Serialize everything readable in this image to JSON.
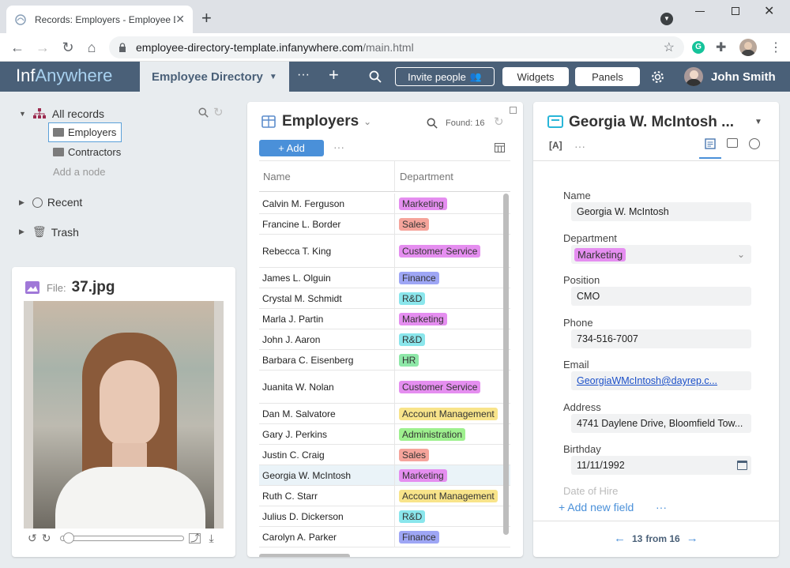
{
  "browser": {
    "tab_title": "Records: Employers - Employee D",
    "new_tab_label": "+",
    "url_host": "employee-directory-template.infanywhere.com",
    "url_path": "/main.html"
  },
  "app": {
    "logo_inf": "Inf",
    "logo_anywhere": "Anywhere",
    "directory_tab": "Employee Directory",
    "invite_label": "Invite people",
    "widgets_label": "Widgets",
    "panels_label": "Panels",
    "user_name": "John Smith",
    "more_label": "···",
    "add_label": "+"
  },
  "tree": {
    "all_records": "All records",
    "employers": "Employers",
    "contractors": "Contractors",
    "add_node": "Add a node",
    "recent": "Recent",
    "trash": "Trash"
  },
  "file_panel": {
    "file_label": "File:",
    "file_name": "37.jpg"
  },
  "table": {
    "title": "Employers",
    "found_label": "Found: 16",
    "add_label": "+ Add",
    "col_name": "Name",
    "col_department": "Department",
    "rows": [
      {
        "name": "Calvin M. Ferguson",
        "dept": "Marketing"
      },
      {
        "name": "Francine L. Border",
        "dept": "Sales"
      },
      {
        "name": "Rebecca T. King",
        "dept": "Customer Service"
      },
      {
        "name": "James L. Olguin",
        "dept": "Finance"
      },
      {
        "name": "Crystal M. Schmidt",
        "dept": "R&D"
      },
      {
        "name": "Marla J. Partin",
        "dept": "Marketing"
      },
      {
        "name": "John J. Aaron",
        "dept": "R&D"
      },
      {
        "name": "Barbara C. Eisenberg",
        "dept": "HR"
      },
      {
        "name": "Juanita W. Nolan",
        "dept": "Customer Service"
      },
      {
        "name": "Dan M. Salvatore",
        "dept": "Account Management"
      },
      {
        "name": "Gary J. Perkins",
        "dept": "Administration"
      },
      {
        "name": "Justin C. Craig",
        "dept": "Sales"
      },
      {
        "name": "Georgia W. McIntosh",
        "dept": "Marketing"
      },
      {
        "name": "Ruth C. Starr",
        "dept": "Account Management"
      },
      {
        "name": "Julius D. Dickerson",
        "dept": "R&D"
      },
      {
        "name": "Carolyn A. Parker",
        "dept": "Finance"
      }
    ]
  },
  "dept_colors": {
    "Marketing": "#e58ef0",
    "Sales": "#f5a49b",
    "Customer Service": "#e58ef0",
    "Finance": "#9ea6f5",
    "R&D": "#8ae6ec",
    "HR": "#8ee8a8",
    "Account Management": "#f8e48a",
    "Administration": "#9ef08e"
  },
  "detail": {
    "title": "Georgia W. McIntosh ...",
    "fields": {
      "name_label": "Name",
      "name": "Georgia W. McIntosh",
      "department_label": "Department",
      "department": "Marketing",
      "position_label": "Position",
      "position": "CMO",
      "phone_label": "Phone",
      "phone": "734-516-7007",
      "email_label": "Email",
      "email": "GeorgiaWMcIntosh@dayrep.c...",
      "address_label": "Address",
      "address": "4741 Daylene Drive, Bloomfield Tow...",
      "birthday_label": "Birthday",
      "birthday": "11/11/1992",
      "hire_label": "Date of Hire"
    },
    "add_field": "+ Add new field",
    "pager_current": "13",
    "pager_text": "from 16"
  }
}
